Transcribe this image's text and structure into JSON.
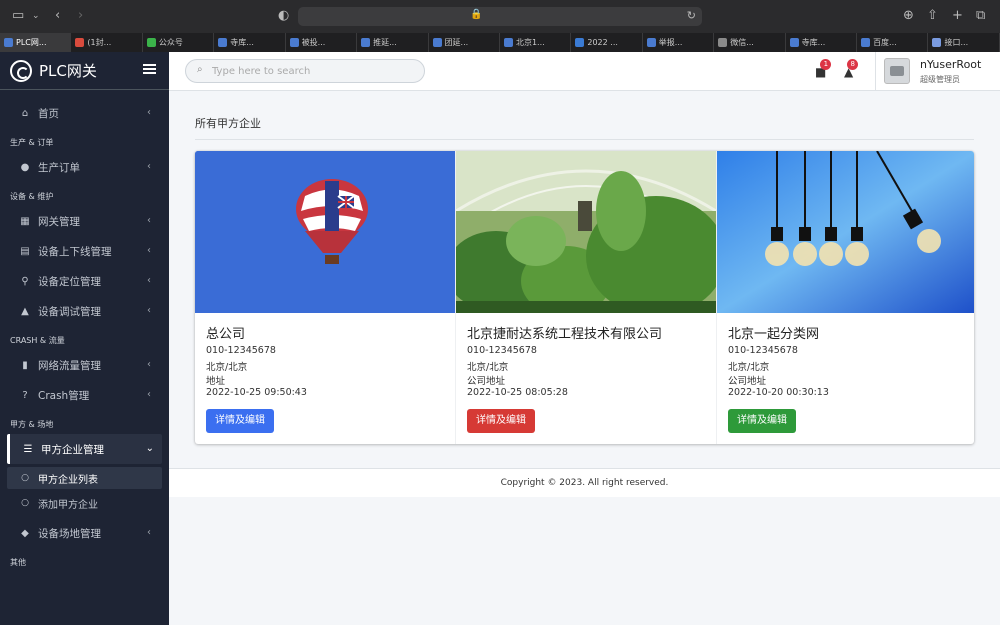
{
  "browser": {
    "tabs": [
      {
        "label": "PLC网...",
        "active": true
      },
      {
        "label": "(1封..."
      },
      {
        "label": "公众号"
      },
      {
        "label": "寺库..."
      },
      {
        "label": "被投..."
      },
      {
        "label": "推延..."
      },
      {
        "label": "团延..."
      },
      {
        "label": "北京1..."
      },
      {
        "label": "2022 ..."
      },
      {
        "label": "举报..."
      },
      {
        "label": "微信..."
      },
      {
        "label": "寺库..."
      },
      {
        "label": "百度..."
      },
      {
        "label": "接口..."
      }
    ]
  },
  "brand": {
    "name": "PLC网关"
  },
  "nav": {
    "home": "首页",
    "h_production": "生产 & 订单",
    "production_order": "生产订单",
    "h_device": "设备 & 维护",
    "gateway": "网关管理",
    "device_online": "设备上下线管理",
    "device_location": "设备定位管理",
    "device_debug": "设备调试管理",
    "h_crash": "CRASH & 流量",
    "traffic": "网络流量管理",
    "crash": "Crash管理",
    "h_party": "甲方 & 场地",
    "party_mgmt": "甲方企业管理",
    "party_list": "甲方企业列表",
    "party_add": "添加甲方企业",
    "site_mgmt": "设备场地管理",
    "h_other": "其他"
  },
  "search": {
    "placeholder": "Type here to search"
  },
  "header": {
    "messages_badge": "1",
    "notifications_badge": "8",
    "user_name": "nYuserRoot",
    "user_role": "超级管理员"
  },
  "page": {
    "title": "所有甲方企业"
  },
  "companies": [
    {
      "name": "总公司",
      "phone": "010-12345678",
      "region": "北京/北京",
      "address": "地址",
      "time": "2022-10-25 09:50:43",
      "button": "详情及编辑",
      "button_color": "#3b6ff0"
    },
    {
      "name": "北京捷耐达系统工程技术有限公司",
      "phone": "010-12345678",
      "region": "北京/北京",
      "address": "公司地址",
      "time": "2022-10-25 08:05:28",
      "button": "详情及编辑",
      "button_color": "#d63a35"
    },
    {
      "name": "北京一起分类网",
      "phone": "010-12345678",
      "region": "北京/北京",
      "address": "公司地址",
      "time": "2022-10-20 00:30:13",
      "button": "详情及编辑",
      "button_color": "#2e9a3a"
    }
  ],
  "footer": {
    "text": "Copyright © 2023. All right reserved."
  }
}
